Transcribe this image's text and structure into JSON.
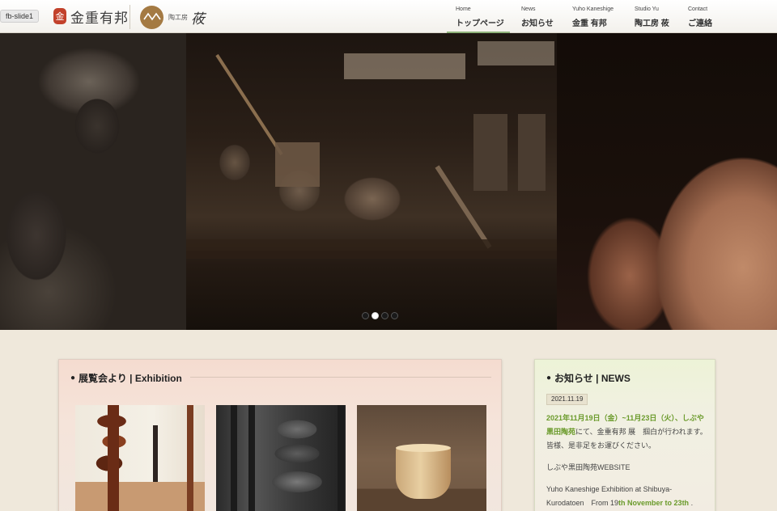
{
  "slide_tag": "fb-slide1",
  "header": {
    "logo1": {
      "seal": "金",
      "text": "金重有邦"
    },
    "logo2": {
      "small": "陶工房",
      "big": "莜"
    }
  },
  "nav": [
    {
      "en": "Home",
      "jp": "トップページ",
      "active": true
    },
    {
      "en": "News",
      "jp": "お知らせ"
    },
    {
      "en": "Yuho Kaneshige",
      "jp": "金重 有邦"
    },
    {
      "en": "Studio Yu",
      "jp": "陶工房 莜"
    },
    {
      "en": "Contact",
      "jp": "ご連絡"
    }
  ],
  "hero": {
    "slide_count": 4,
    "active_slide": 2
  },
  "exhibition": {
    "bullet": "●",
    "title": "展覧会より | Exhibition"
  },
  "news": {
    "bullet": "●",
    "title": "お知らせ | NEWS",
    "date": "2021.11.19",
    "p1_green": "2021年11月19日（金）~11月23日（火）、しぶや黒田陶苑",
    "p1_rest": "にて、金重有邦 展　掴白が行われます。皆様、是非足をお運びください。",
    "p2": "しぶや黒田陶苑WEBSITE",
    "p3_a": "Yuho Kaneshige Exhibition at Shibuya-Kurodatoen　From 19",
    "p3_b": "th November to 23th",
    "p3_c": " ."
  },
  "colors": {
    "accent_green": "#6a9a2a",
    "active_nav_underline": "#8fb37a",
    "exhibition_card": "#f5dcd0",
    "news_card": "#edf3d7"
  }
}
